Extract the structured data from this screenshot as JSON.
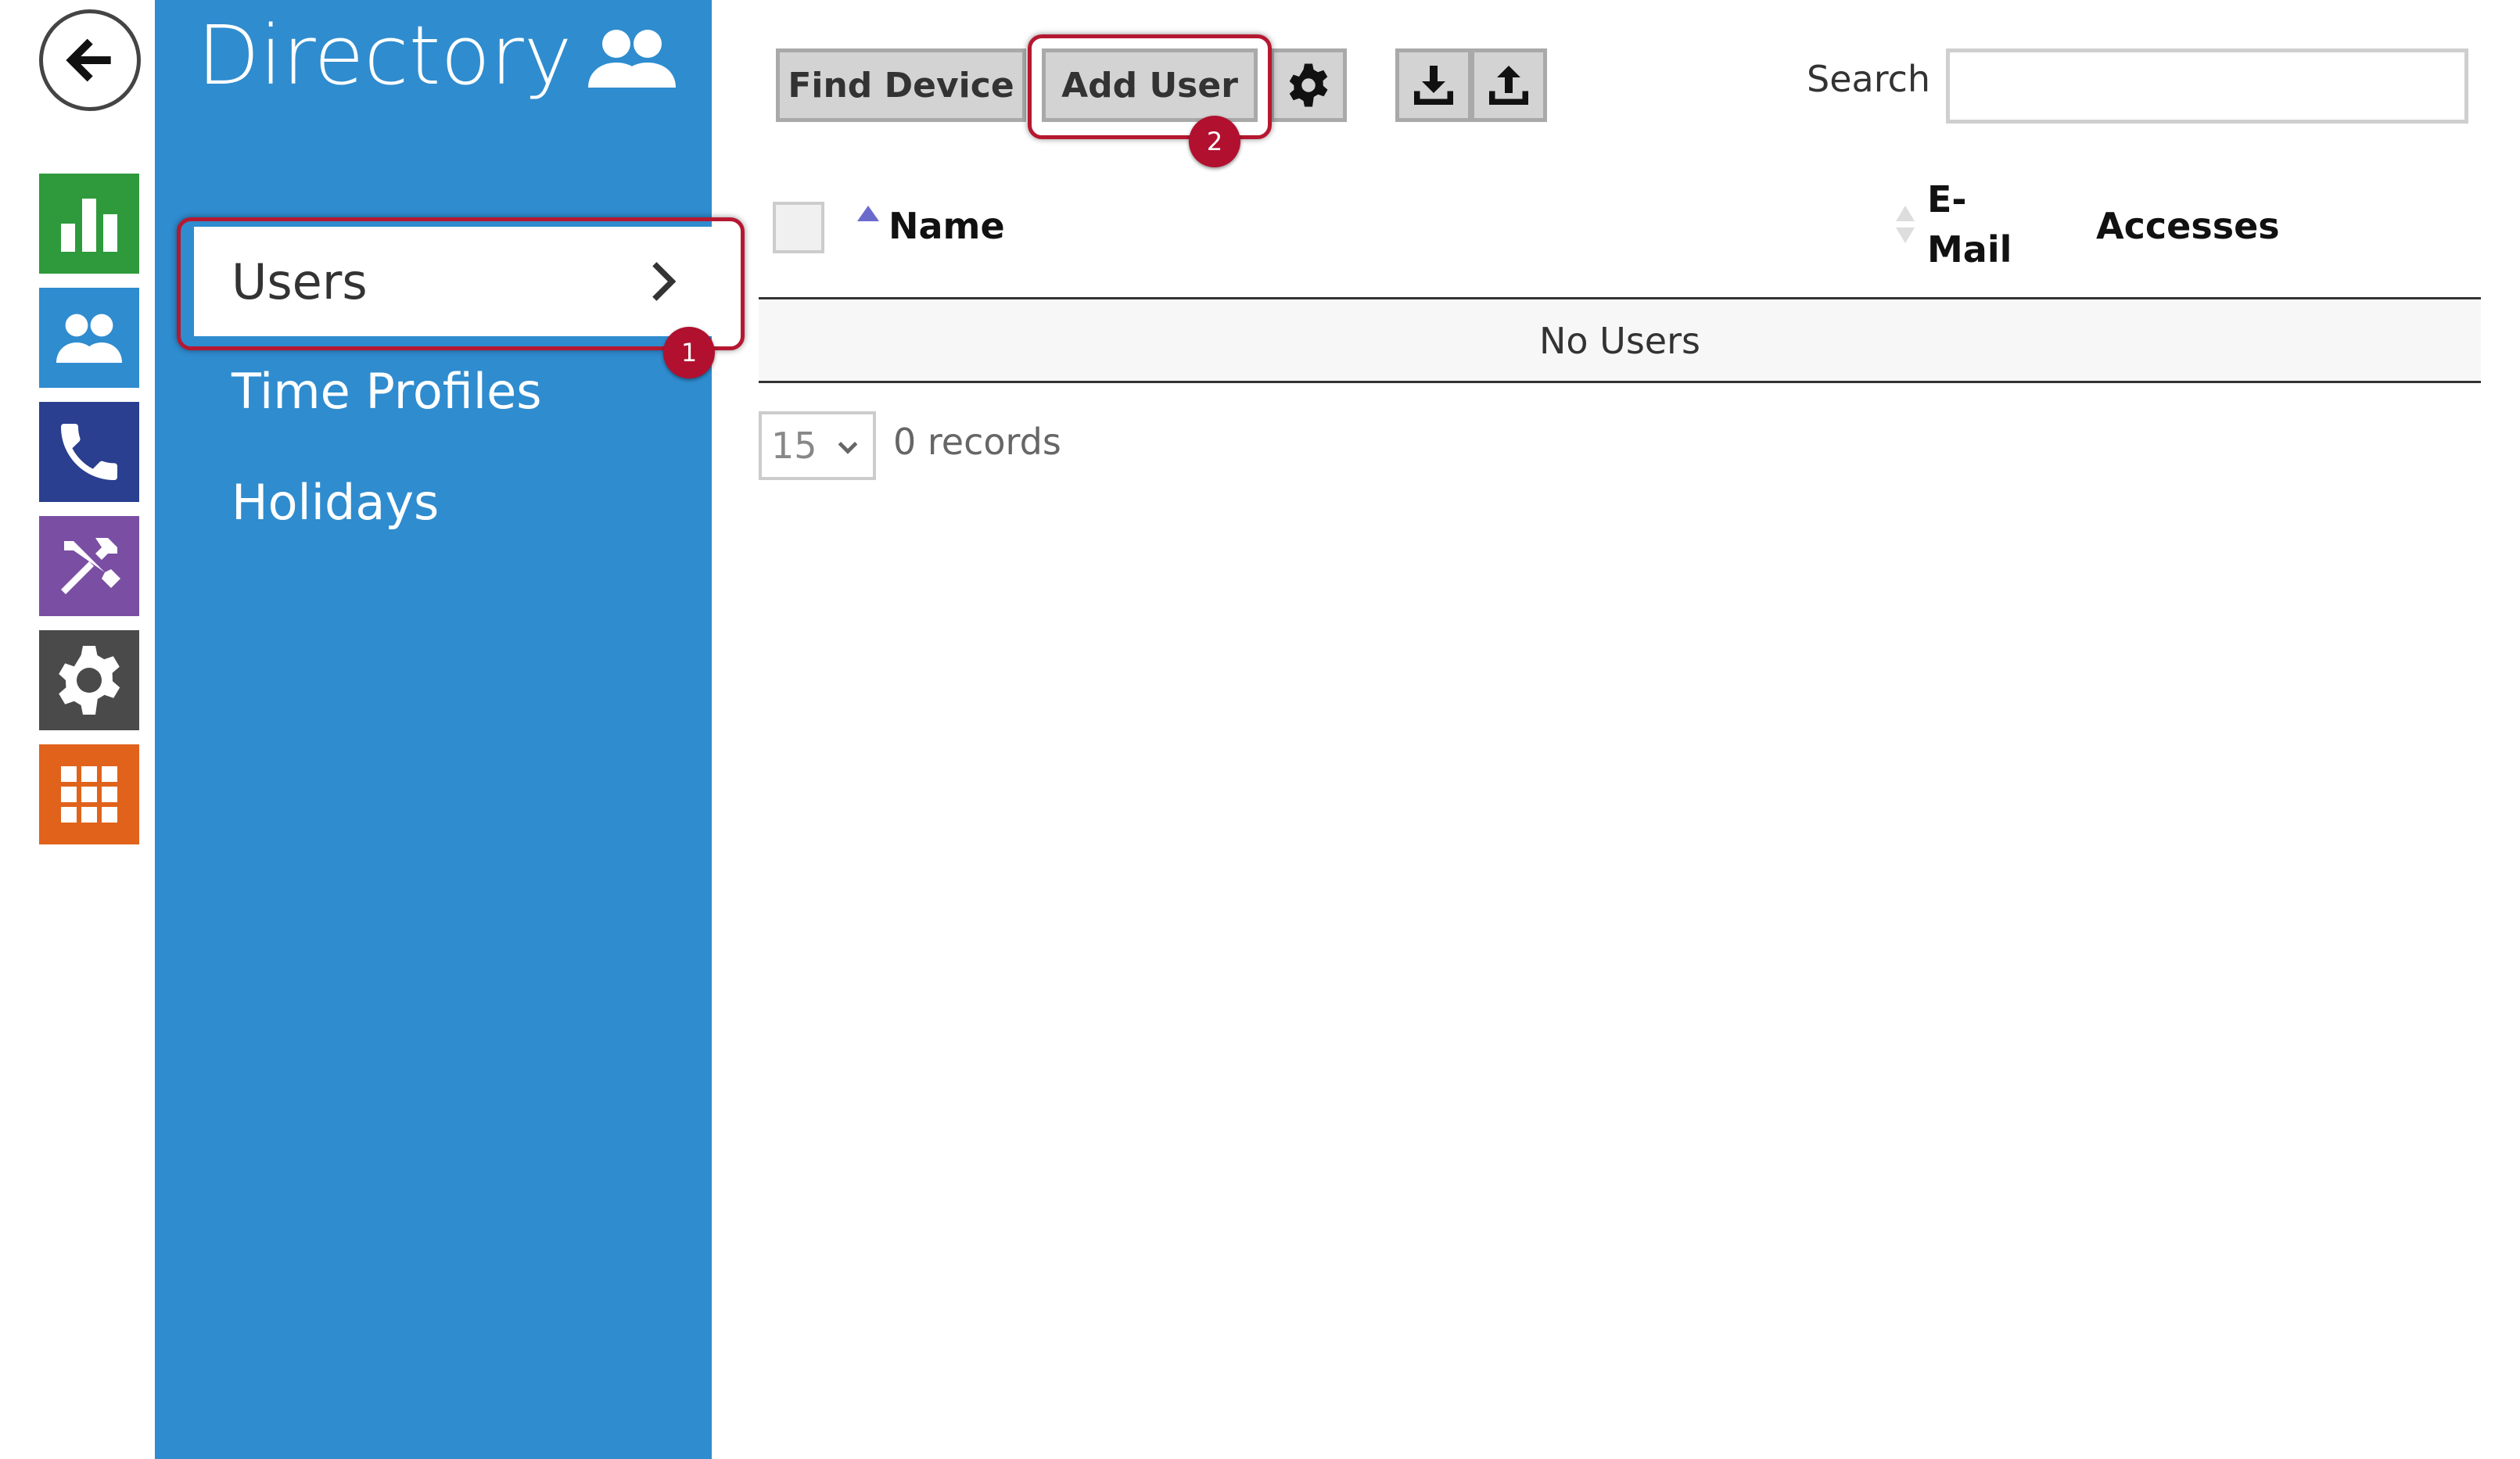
{
  "rail": {
    "back_icon": "arrow-left-icon",
    "tiles": [
      {
        "icon": "bar-chart-icon",
        "color": "#2e9a3c"
      },
      {
        "icon": "users-icon",
        "color": "#2f8ccf"
      },
      {
        "icon": "phone-icon",
        "color": "#2a3f8f"
      },
      {
        "icon": "tools-icon",
        "color": "#7a4fa3"
      },
      {
        "icon": "gear-icon",
        "color": "#4a4a4a"
      },
      {
        "icon": "apps-grid-icon",
        "color": "#e0621b"
      }
    ]
  },
  "sidebar": {
    "title": "Directory",
    "title_icon": "users-icon",
    "items": [
      {
        "label": "Users",
        "active": true
      },
      {
        "label": "Time Profiles",
        "active": false
      },
      {
        "label": "Holidays",
        "active": false
      }
    ]
  },
  "callouts": {
    "first": "1",
    "second": "2",
    "color": "#b2102f"
  },
  "toolbar": {
    "find_device": "Find Device",
    "add_user": "Add User",
    "settings_icon": "gear-icon",
    "download_icon": "download-icon",
    "upload_icon": "upload-icon",
    "search_label": "Search",
    "search_value": ""
  },
  "table": {
    "columns": [
      "Name",
      "E-",
      "Mail",
      "Accesses"
    ],
    "empty_message": "No Users"
  },
  "pagination": {
    "page_size": "15",
    "records": "0 records"
  }
}
